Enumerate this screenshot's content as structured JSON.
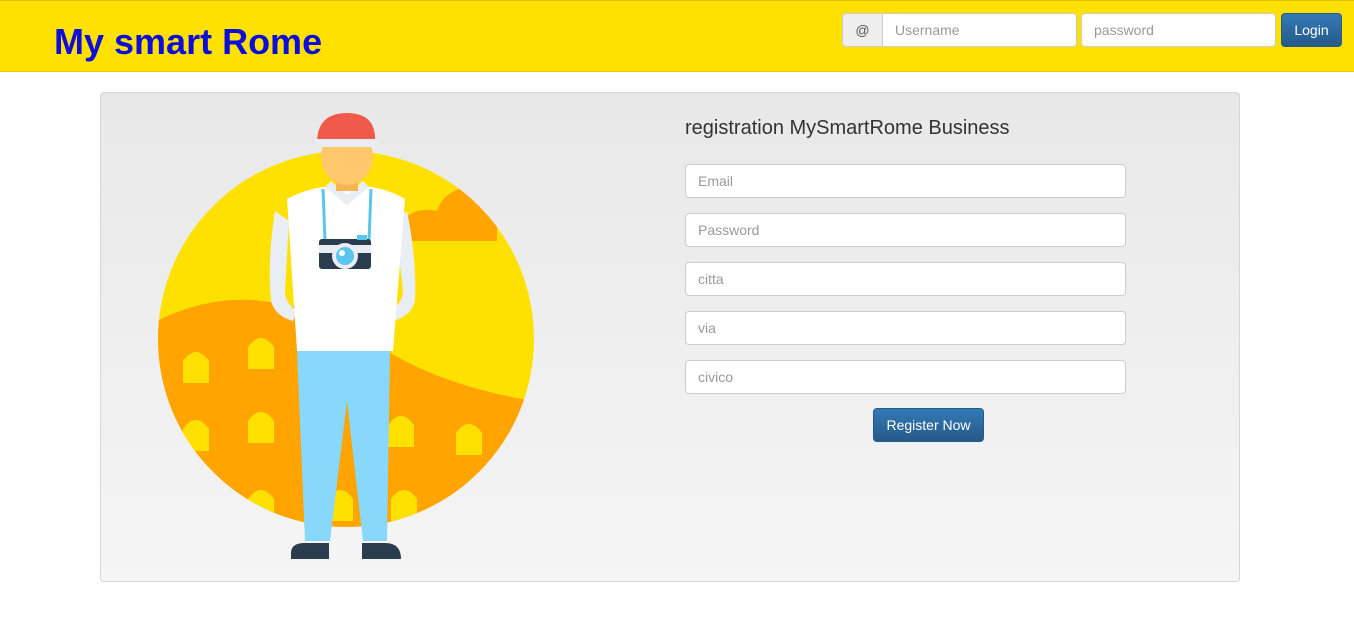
{
  "navbar": {
    "brand": "My smart Rome",
    "at_symbol": "@",
    "username_placeholder": "Username",
    "password_placeholder": "password",
    "login_label": "Login"
  },
  "registration": {
    "title": "registration MySmartRome Business",
    "fields": {
      "email": "Email",
      "password": "Password",
      "citta": "citta",
      "via": "via",
      "civico": "civico"
    },
    "submit_label": "Register Now"
  },
  "colors": {
    "navbar_bg": "#ffe100",
    "brand_text": "#0d0ddb",
    "primary_button": "#337ab7"
  },
  "illustration": {
    "icon": "tourist-with-camera-colosseum-icon"
  }
}
